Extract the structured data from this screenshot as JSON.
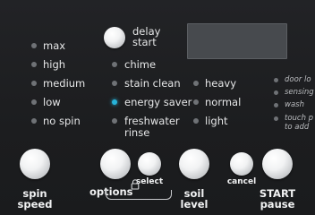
{
  "spin_speed": {
    "options": [
      "max",
      "high",
      "medium",
      "low",
      "no spin"
    ],
    "label_line1": "spin",
    "label_line2": "speed"
  },
  "options": {
    "delay_start_line1": "delay",
    "delay_start_line2": "start",
    "items": [
      "chime",
      "stain clean",
      "energy saver",
      "freshwater",
      "rinse"
    ],
    "active_item": "energy saver",
    "select_label": "select",
    "label": "options"
  },
  "soil_level": {
    "options": [
      "heavy",
      "normal",
      "light"
    ],
    "label_line1": "soil",
    "label_line2": "level"
  },
  "cancel": {
    "label": "cancel"
  },
  "status": {
    "items": [
      "door lo",
      "sensing",
      "wash",
      "touch p",
      "to add"
    ]
  },
  "start": {
    "label_line1": "START",
    "label_line2": "pause"
  },
  "colors": {
    "indicator_lit": "#27b3d9",
    "indicator_off": "#6f7276"
  }
}
